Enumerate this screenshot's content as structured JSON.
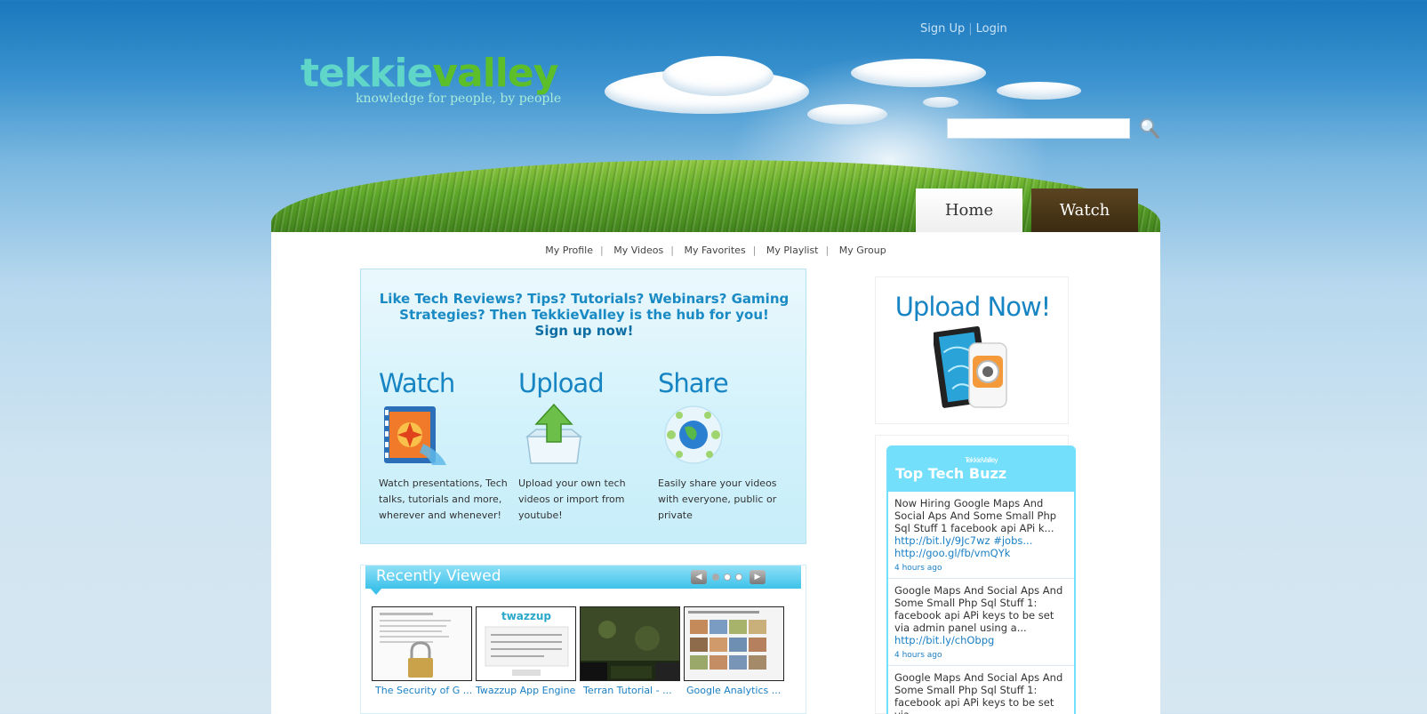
{
  "header": {
    "signup_label": "Sign Up",
    "login_label": "Login",
    "logo": {
      "part1": "tekkie",
      "part2": "valley"
    },
    "tagline": "knowledge for people, by people",
    "search": {
      "placeholder": "",
      "value": ""
    }
  },
  "tabs": [
    {
      "label": "Home",
      "active": true
    },
    {
      "label": "Watch",
      "active": false
    }
  ],
  "subnav": [
    "My Profile",
    "My Videos",
    "My Favorites",
    "My Playlist",
    "My Group"
  ],
  "hero": {
    "headline": "Like Tech Reviews? Tips? Tutorials? Webinars? Gaming Strategies? Then TekkieValley is the hub for you!",
    "cta": "Sign up now!",
    "features": [
      {
        "title": "Watch",
        "desc": "Watch presentations, Tech talks, tutorials and more, wherever and whenever!",
        "icon": "film-icon"
      },
      {
        "title": "Upload",
        "desc": "Upload your own tech videos or import from youtube!",
        "icon": "upload-box-icon"
      },
      {
        "title": "Share",
        "desc": "Easily share your videos with everyone, public or private",
        "icon": "globe-share-icon"
      }
    ]
  },
  "recent": {
    "title": "Recently Viewed",
    "items": [
      {
        "label": "The Security of G ..."
      },
      {
        "label": "Twazzup App Engine"
      },
      {
        "label": "Terran Tutorial - ..."
      },
      {
        "label": "Google Analytics ..."
      }
    ]
  },
  "upload_card": {
    "title": "Upload Now!"
  },
  "buzz": {
    "brand": "TekkieValley",
    "title": "Top Tech Buzz",
    "items": [
      {
        "text": "Now Hiring Google Maps And Social Aps And Some Small Php Sql Stuff 1 facebook api APi k...",
        "links": [
          "http://bit.ly/9Jc7wz",
          "#jobs...",
          "http://goo.gl/fb/vmQYk"
        ],
        "time": "4 hours ago"
      },
      {
        "text": "Google Maps And Social Aps And Some Small Php Sql Stuff 1: facebook api APi keys to be set via admin panel using a...",
        "links": [
          "http://bit.ly/chObpg"
        ],
        "time": "4 hours ago"
      },
      {
        "text": "Google Maps And Social Aps And Some Small Php Sql Stuff 1: facebook api APi keys to be set via",
        "links": [],
        "time": ""
      }
    ]
  },
  "colors": {
    "accent_blue": "#1785c3",
    "buzz_cyan": "#73dffb",
    "watch_tab_brown": "#4a3515",
    "grass_green": "#5ea82a"
  }
}
